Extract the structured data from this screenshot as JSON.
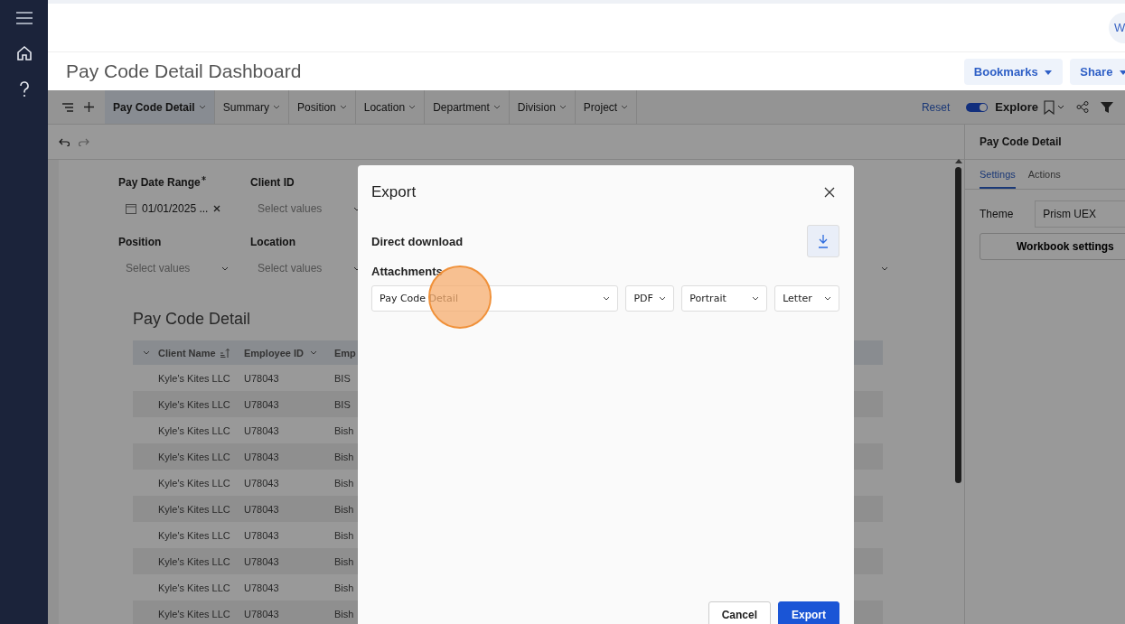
{
  "header": {
    "avatar": "W"
  },
  "page": {
    "title": "Pay Code Detail Dashboard",
    "buttons": [
      "Bookmarks",
      "Share"
    ]
  },
  "toolbar": {
    "tabs": [
      {
        "label": "Pay Code Detail",
        "selected": true
      },
      {
        "label": "Summary",
        "selected": false
      },
      {
        "label": "Position",
        "selected": false
      },
      {
        "label": "Location",
        "selected": false
      },
      {
        "label": "Department",
        "selected": false
      },
      {
        "label": "Division",
        "selected": false
      },
      {
        "label": "Project",
        "selected": false
      }
    ],
    "reset": "Reset",
    "explore": {
      "label": "Explore",
      "on": true
    }
  },
  "filters": [
    {
      "kind": "date",
      "label": "Pay Date Range",
      "required": true,
      "value": "01/01/2025 ..."
    },
    {
      "kind": "select",
      "label": "Client ID",
      "required": false,
      "placeholder": "Select values"
    },
    {
      "kind": "select",
      "label": "Position",
      "required": false,
      "placeholder": "Select values"
    },
    {
      "kind": "select",
      "label": "Location",
      "required": false,
      "placeholder": "Select values"
    }
  ],
  "table": {
    "title": "Pay Code Detail",
    "columns": [
      {
        "menu": true,
        "sorted": false
      },
      {
        "label": "Client Name",
        "menu": false,
        "sorted": true
      },
      {
        "label": "Employee ID",
        "menu": true,
        "sorted": false
      },
      {
        "label": "Emp"
      }
    ],
    "rows": [
      {
        "cells": [
          "",
          "Kyle's Kites LLC",
          "U78043",
          "BIS"
        ]
      },
      {
        "cells": [
          "",
          "Kyle's Kites LLC",
          "U78043",
          "BIS"
        ]
      },
      {
        "cells": [
          "",
          "Kyle's Kites LLC",
          "U78043",
          "Bish"
        ]
      },
      {
        "cells": [
          "",
          "Kyle's Kites LLC",
          "U78043",
          "Bish"
        ]
      },
      {
        "cells": [
          "",
          "Kyle's Kites LLC",
          "U78043",
          "Bish"
        ]
      },
      {
        "cells": [
          "",
          "Kyle's Kites LLC",
          "U78043",
          "Bish"
        ]
      },
      {
        "cells": [
          "",
          "Kyle's Kites LLC",
          "U78043",
          "Bish"
        ]
      },
      {
        "cells": [
          "",
          "Kyle's Kites LLC",
          "U78043",
          "Bish"
        ]
      },
      {
        "cells": [
          "",
          "Kyle's Kites LLC",
          "U78043",
          "Bish"
        ]
      },
      {
        "cells": [
          "",
          "Kyle's Kites LLC",
          "U78043",
          "Bish"
        ]
      }
    ]
  },
  "dialog": {
    "title": "Export",
    "direct_download": "Direct download",
    "attachments": "Attachments",
    "selects": [
      "Pay Code Detail",
      "PDF",
      "Portrait",
      "Letter"
    ],
    "buttons": [
      {
        "label": "Cancel",
        "kind": "secondary"
      },
      {
        "label": "Export",
        "kind": "primary"
      }
    ]
  },
  "panel": {
    "title": "Pay Code Detail",
    "tabs": [
      {
        "label": "Settings",
        "selected": true
      },
      {
        "label": "Actions",
        "selected": false
      }
    ],
    "theme_label": "Theme",
    "theme_value": "Prism UEX",
    "button": "Workbook settings"
  }
}
